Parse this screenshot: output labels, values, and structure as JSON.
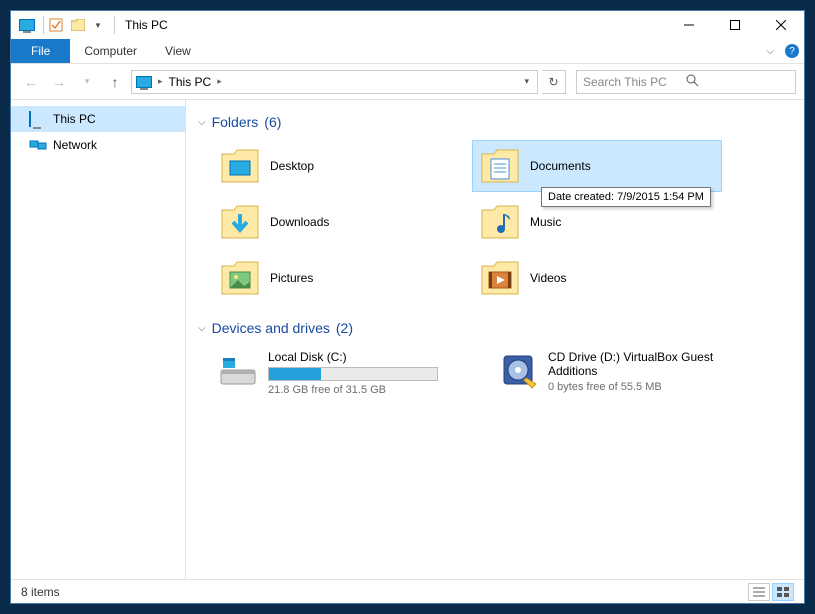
{
  "title": "This PC",
  "menu": {
    "file": "File",
    "computer": "Computer",
    "view": "View"
  },
  "breadcrumb": "This PC",
  "search_placeholder": "Search This PC",
  "sidebar": {
    "items": [
      {
        "label": "This PC",
        "selected": true
      },
      {
        "label": "Network",
        "selected": false
      }
    ]
  },
  "groups": {
    "folders": {
      "label": "Folders",
      "count": "(6)",
      "items": [
        {
          "name": "Desktop"
        },
        {
          "name": "Documents",
          "selected": true
        },
        {
          "name": "Downloads"
        },
        {
          "name": "Music"
        },
        {
          "name": "Pictures"
        },
        {
          "name": "Videos"
        }
      ]
    },
    "drives": {
      "label": "Devices and drives",
      "count": "(2)",
      "items": [
        {
          "name": "Local Disk (C:)",
          "stats": "21.8 GB free of 31.5 GB",
          "fill_pct": 31
        },
        {
          "name": "CD Drive (D:) VirtualBox Guest Additions",
          "stats": "0 bytes free of 55.5 MB"
        }
      ]
    }
  },
  "tooltip": "Date created: 7/9/2015 1:54 PM",
  "status": "8 items"
}
